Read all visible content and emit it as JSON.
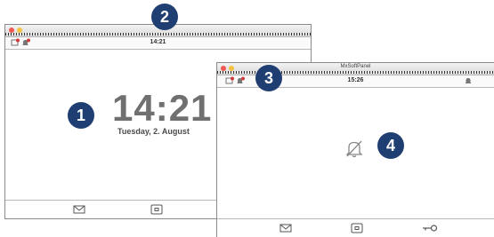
{
  "window_left": {
    "title": "",
    "time": "14:21",
    "clock": {
      "time": "14:21",
      "date": "Tuesday, 2. August"
    }
  },
  "window_right": {
    "title": "MxSoftPanel",
    "time": "15:26"
  },
  "callouts": [
    "1",
    "2",
    "3",
    "4"
  ],
  "icons": [
    "message-icon",
    "bell-alert-icon",
    "envelope-icon",
    "camera-icon",
    "key-icon",
    "bell-off-icon"
  ]
}
